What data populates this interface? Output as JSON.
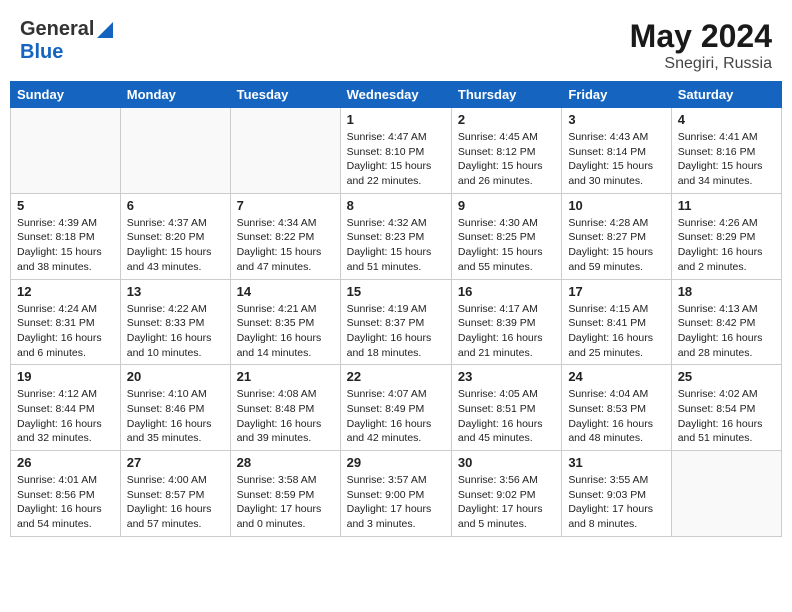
{
  "header": {
    "logo_general": "General",
    "logo_blue": "Blue",
    "month_year": "May 2024",
    "location": "Snegiri, Russia"
  },
  "days_of_week": [
    "Sunday",
    "Monday",
    "Tuesday",
    "Wednesday",
    "Thursday",
    "Friday",
    "Saturday"
  ],
  "weeks": [
    [
      {
        "day": "",
        "info": ""
      },
      {
        "day": "",
        "info": ""
      },
      {
        "day": "",
        "info": ""
      },
      {
        "day": "1",
        "info": "Sunrise: 4:47 AM\nSunset: 8:10 PM\nDaylight: 15 hours\nand 22 minutes."
      },
      {
        "day": "2",
        "info": "Sunrise: 4:45 AM\nSunset: 8:12 PM\nDaylight: 15 hours\nand 26 minutes."
      },
      {
        "day": "3",
        "info": "Sunrise: 4:43 AM\nSunset: 8:14 PM\nDaylight: 15 hours\nand 30 minutes."
      },
      {
        "day": "4",
        "info": "Sunrise: 4:41 AM\nSunset: 8:16 PM\nDaylight: 15 hours\nand 34 minutes."
      }
    ],
    [
      {
        "day": "5",
        "info": "Sunrise: 4:39 AM\nSunset: 8:18 PM\nDaylight: 15 hours\nand 38 minutes."
      },
      {
        "day": "6",
        "info": "Sunrise: 4:37 AM\nSunset: 8:20 PM\nDaylight: 15 hours\nand 43 minutes."
      },
      {
        "day": "7",
        "info": "Sunrise: 4:34 AM\nSunset: 8:22 PM\nDaylight: 15 hours\nand 47 minutes."
      },
      {
        "day": "8",
        "info": "Sunrise: 4:32 AM\nSunset: 8:23 PM\nDaylight: 15 hours\nand 51 minutes."
      },
      {
        "day": "9",
        "info": "Sunrise: 4:30 AM\nSunset: 8:25 PM\nDaylight: 15 hours\nand 55 minutes."
      },
      {
        "day": "10",
        "info": "Sunrise: 4:28 AM\nSunset: 8:27 PM\nDaylight: 15 hours\nand 59 minutes."
      },
      {
        "day": "11",
        "info": "Sunrise: 4:26 AM\nSunset: 8:29 PM\nDaylight: 16 hours\nand 2 minutes."
      }
    ],
    [
      {
        "day": "12",
        "info": "Sunrise: 4:24 AM\nSunset: 8:31 PM\nDaylight: 16 hours\nand 6 minutes."
      },
      {
        "day": "13",
        "info": "Sunrise: 4:22 AM\nSunset: 8:33 PM\nDaylight: 16 hours\nand 10 minutes."
      },
      {
        "day": "14",
        "info": "Sunrise: 4:21 AM\nSunset: 8:35 PM\nDaylight: 16 hours\nand 14 minutes."
      },
      {
        "day": "15",
        "info": "Sunrise: 4:19 AM\nSunset: 8:37 PM\nDaylight: 16 hours\nand 18 minutes."
      },
      {
        "day": "16",
        "info": "Sunrise: 4:17 AM\nSunset: 8:39 PM\nDaylight: 16 hours\nand 21 minutes."
      },
      {
        "day": "17",
        "info": "Sunrise: 4:15 AM\nSunset: 8:41 PM\nDaylight: 16 hours\nand 25 minutes."
      },
      {
        "day": "18",
        "info": "Sunrise: 4:13 AM\nSunset: 8:42 PM\nDaylight: 16 hours\nand 28 minutes."
      }
    ],
    [
      {
        "day": "19",
        "info": "Sunrise: 4:12 AM\nSunset: 8:44 PM\nDaylight: 16 hours\nand 32 minutes."
      },
      {
        "day": "20",
        "info": "Sunrise: 4:10 AM\nSunset: 8:46 PM\nDaylight: 16 hours\nand 35 minutes."
      },
      {
        "day": "21",
        "info": "Sunrise: 4:08 AM\nSunset: 8:48 PM\nDaylight: 16 hours\nand 39 minutes."
      },
      {
        "day": "22",
        "info": "Sunrise: 4:07 AM\nSunset: 8:49 PM\nDaylight: 16 hours\nand 42 minutes."
      },
      {
        "day": "23",
        "info": "Sunrise: 4:05 AM\nSunset: 8:51 PM\nDaylight: 16 hours\nand 45 minutes."
      },
      {
        "day": "24",
        "info": "Sunrise: 4:04 AM\nSunset: 8:53 PM\nDaylight: 16 hours\nand 48 minutes."
      },
      {
        "day": "25",
        "info": "Sunrise: 4:02 AM\nSunset: 8:54 PM\nDaylight: 16 hours\nand 51 minutes."
      }
    ],
    [
      {
        "day": "26",
        "info": "Sunrise: 4:01 AM\nSunset: 8:56 PM\nDaylight: 16 hours\nand 54 minutes."
      },
      {
        "day": "27",
        "info": "Sunrise: 4:00 AM\nSunset: 8:57 PM\nDaylight: 16 hours\nand 57 minutes."
      },
      {
        "day": "28",
        "info": "Sunrise: 3:58 AM\nSunset: 8:59 PM\nDaylight: 17 hours\nand 0 minutes."
      },
      {
        "day": "29",
        "info": "Sunrise: 3:57 AM\nSunset: 9:00 PM\nDaylight: 17 hours\nand 3 minutes."
      },
      {
        "day": "30",
        "info": "Sunrise: 3:56 AM\nSunset: 9:02 PM\nDaylight: 17 hours\nand 5 minutes."
      },
      {
        "day": "31",
        "info": "Sunrise: 3:55 AM\nSunset: 9:03 PM\nDaylight: 17 hours\nand 8 minutes."
      },
      {
        "day": "",
        "info": ""
      }
    ]
  ]
}
